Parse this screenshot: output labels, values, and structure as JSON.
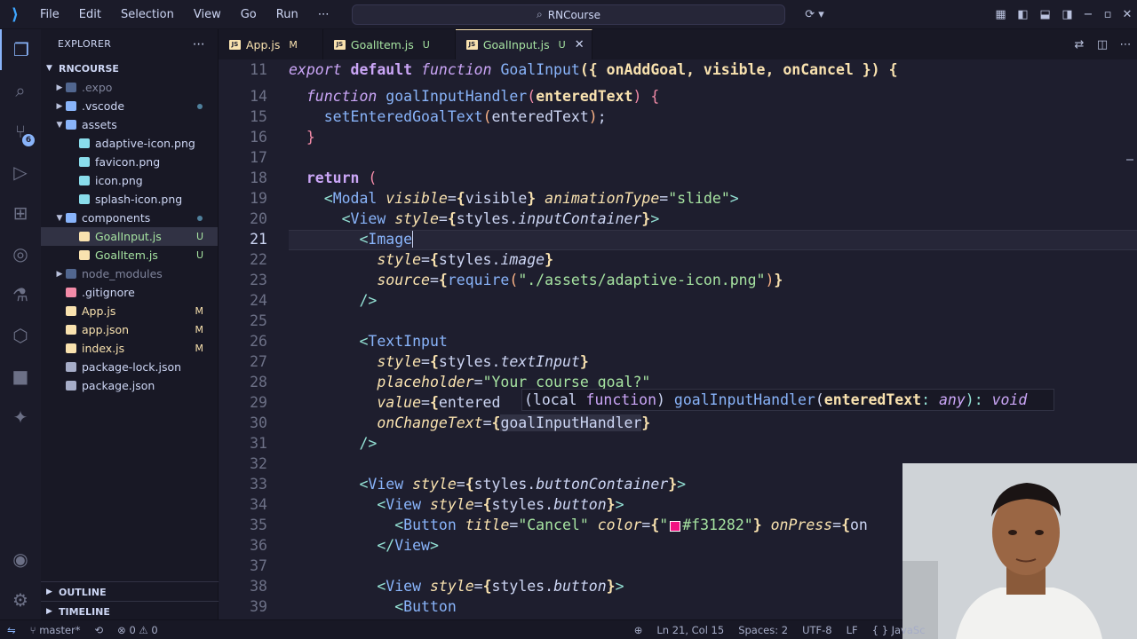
{
  "menu": [
    "File",
    "Edit",
    "Selection",
    "View",
    "Go",
    "Run",
    "⋯"
  ],
  "command_center": "RNCourse",
  "explorer": {
    "header": "EXPLORER",
    "project": "RNCOURSE",
    "items": [
      {
        "name": ".expo",
        "type": "folder",
        "depth": 1,
        "expanded": false,
        "status": "",
        "dim": true
      },
      {
        "name": ".vscode",
        "type": "folder",
        "depth": 1,
        "expanded": false,
        "status": "dot"
      },
      {
        "name": "assets",
        "type": "folder",
        "depth": 1,
        "expanded": true,
        "status": ""
      },
      {
        "name": "adaptive-icon.png",
        "type": "image",
        "depth": 2,
        "status": ""
      },
      {
        "name": "favicon.png",
        "type": "image",
        "depth": 2,
        "status": ""
      },
      {
        "name": "icon.png",
        "type": "image",
        "depth": 2,
        "status": ""
      },
      {
        "name": "splash-icon.png",
        "type": "image",
        "depth": 2,
        "status": ""
      },
      {
        "name": "components",
        "type": "folder",
        "depth": 1,
        "expanded": true,
        "status": "dot"
      },
      {
        "name": "GoalInput.js",
        "type": "js",
        "depth": 2,
        "status": "U",
        "selected": true
      },
      {
        "name": "GoalItem.js",
        "type": "js",
        "depth": 2,
        "status": "U"
      },
      {
        "name": "node_modules",
        "type": "folder",
        "depth": 1,
        "expanded": false,
        "status": "",
        "dim": true
      },
      {
        "name": ".gitignore",
        "type": "git",
        "depth": 1,
        "status": ""
      },
      {
        "name": "App.js",
        "type": "js",
        "depth": 1,
        "status": "M"
      },
      {
        "name": "app.json",
        "type": "json",
        "depth": 1,
        "status": "M"
      },
      {
        "name": "index.js",
        "type": "js",
        "depth": 1,
        "status": "M"
      },
      {
        "name": "package-lock.json",
        "type": "npm",
        "depth": 1,
        "status": ""
      },
      {
        "name": "package.json",
        "type": "npm",
        "depth": 1,
        "status": ""
      }
    ],
    "outline": "OUTLINE",
    "timeline": "TIMELINE"
  },
  "tabs": [
    {
      "name": "App.js",
      "status": "M",
      "active": false
    },
    {
      "name": "GoalItem.js",
      "status": "U",
      "active": false
    },
    {
      "name": "GoalInput.js",
      "status": "U",
      "active": true
    }
  ],
  "editor": {
    "line_numbers": [
      "11",
      "14",
      "15",
      "16",
      "17",
      "18",
      "19",
      "20",
      "21",
      "22",
      "23",
      "24",
      "25",
      "26",
      "27",
      "28",
      "29",
      "30",
      "31",
      "32",
      "33",
      "34",
      "35",
      "36",
      "37",
      "38",
      "39"
    ],
    "current_line": "21",
    "hover": "(local function) goalInputHandler(enteredText: any): void",
    "color_value": "#f31282"
  },
  "status": {
    "branch": "master*",
    "problems": "⊗ 0 ⚠ 0",
    "cursor": "Ln 21, Col 15",
    "spaces": "Spaces: 2",
    "encoding": "UTF-8",
    "eol": "LF",
    "lang": "{ } JavaSc"
  },
  "colors": {
    "accent": "#89b4fa",
    "modified": "#f9e2af",
    "untracked": "#a6e3a1",
    "swatch": "#f31282"
  }
}
